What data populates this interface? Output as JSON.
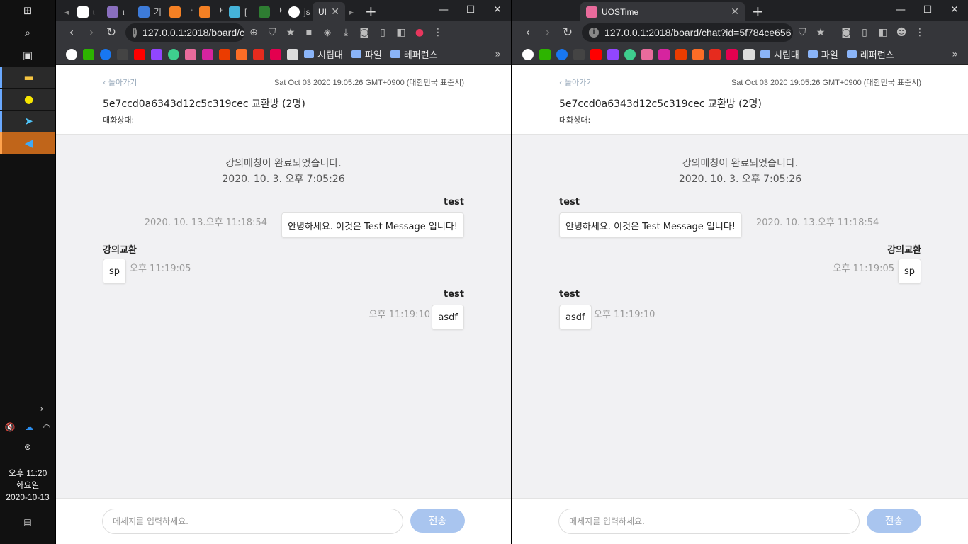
{
  "taskbar": {
    "clock": {
      "time": "오후 11:20",
      "weekday": "화요일",
      "date": "2020-10-13"
    }
  },
  "left_window": {
    "tabs": [
      {
        "label": "ι"
      },
      {
        "label": "ι"
      },
      {
        "label": "기"
      },
      {
        "label": "ᅡ"
      },
      {
        "label": "ᅡ"
      },
      {
        "label": "["
      },
      {
        "label": "ᅡ"
      },
      {
        "label": "js"
      },
      {
        "label": "UI"
      }
    ],
    "address": "127.0.0.1:2018/board/c",
    "page": {
      "back": "‹ 돌아가기",
      "header_date": "Sat Oct 03 2020 19:05:26 GMT+0900 (대한민국 표준시)",
      "room_title": "5e7ccd0a6343d12c5c319cec 교환방 (2명)",
      "partner_label": "대화상대:",
      "system": {
        "text": "강의매칭이 완료되었습니다.",
        "time": "2020. 10. 3. 오후 7:05:26"
      },
      "messages": [
        {
          "sender": "test",
          "text": "안녕하세요. 이것은 Test Message 입니다!",
          "time": "2020. 10. 13.오후 11:18:54"
        },
        {
          "sender": "강의교환",
          "text": "sp",
          "time": "오후 11:19:05"
        },
        {
          "sender": "test",
          "text": "asdf",
          "time": "오후 11:19:10"
        }
      ],
      "input_placeholder": "메세지를 입력하세요.",
      "send": "전송"
    }
  },
  "right_window": {
    "tab_title": "UOSTime",
    "address": "127.0.0.1:2018/board/chat?id=5f784ce656",
    "page": {
      "back": "‹ 돌아가기",
      "header_date": "Sat Oct 03 2020 19:05:26 GMT+0900 (대한민국 표준시)",
      "room_title": "5e7ccd0a6343d12c5c319cec 교환방 (2명)",
      "partner_label": "대화상대:",
      "system": {
        "text": "강의매칭이 완료되었습니다.",
        "time": "2020. 10. 3. 오후 7:05:26"
      },
      "messages": [
        {
          "sender": "test",
          "text": "안녕하세요. 이것은 Test Message 입니다!",
          "time": "2020. 10. 13.오후 11:18:54"
        },
        {
          "sender": "강의교환",
          "text": "sp",
          "time": "오후 11:19:05"
        },
        {
          "sender": "test",
          "text": "asdf",
          "time": "오후 11:19:10"
        }
      ],
      "input_placeholder": "메세지를 입력하세요.",
      "send": "전송"
    }
  },
  "bookmarks": {
    "folders": [
      "시립대",
      "파일",
      "레퍼런스"
    ]
  },
  "colors": {
    "send_button": "#a9c5ef",
    "page_bg": "#f1f1f3",
    "taskbar": "#111111"
  }
}
